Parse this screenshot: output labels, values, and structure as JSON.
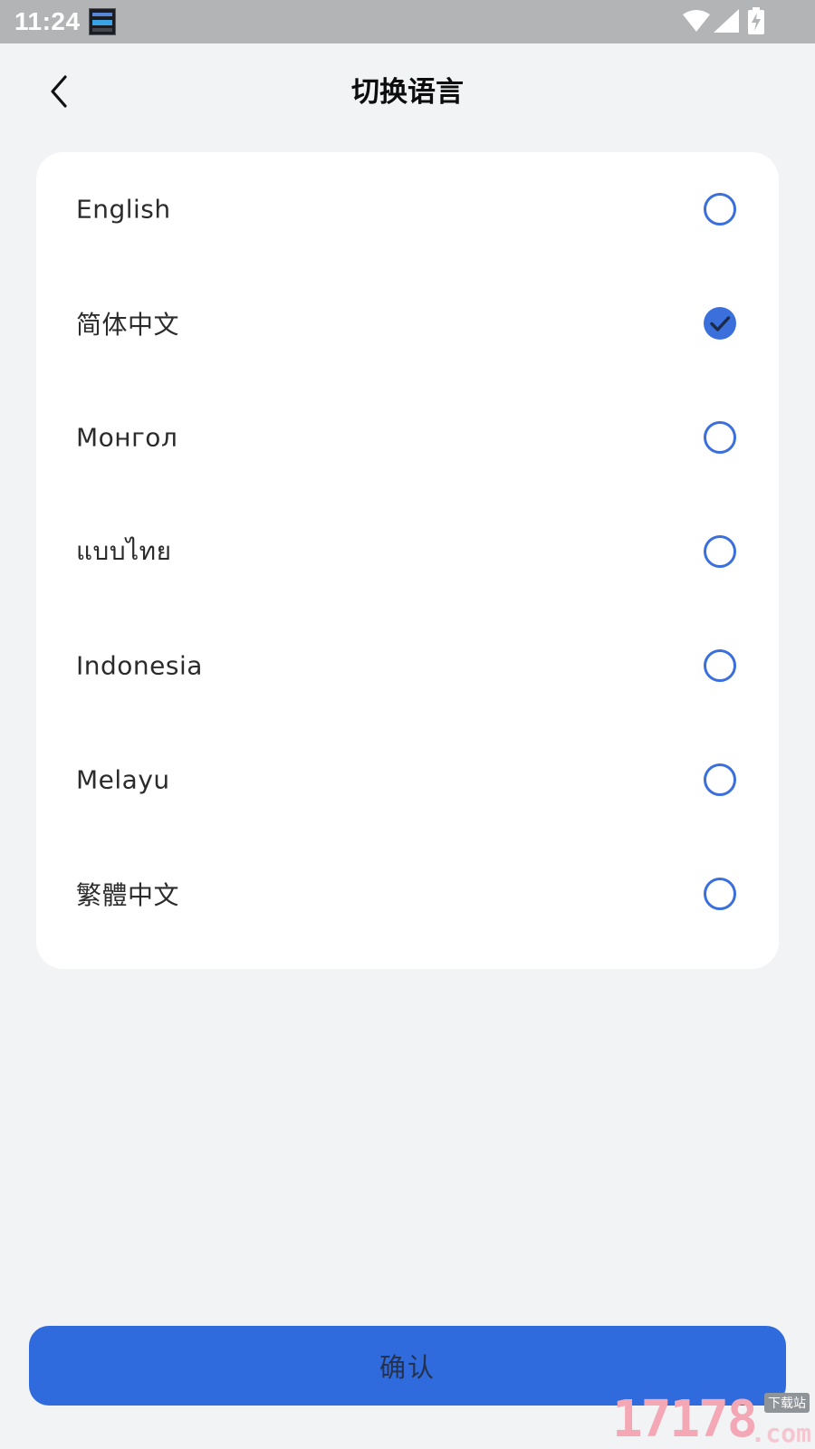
{
  "status_bar": {
    "time": "11:24",
    "icons": [
      "app-notification-icon",
      "wifi-icon",
      "signal-icon",
      "battery-charging-icon"
    ]
  },
  "header": {
    "title": "切换语言",
    "back_icon": "chevron-left-icon"
  },
  "languages": [
    {
      "label": "English",
      "selected": false
    },
    {
      "label": "简体中文",
      "selected": true
    },
    {
      "label": "Монгол",
      "selected": false
    },
    {
      "label": "แบบไทย",
      "selected": false
    },
    {
      "label": "Indonesia",
      "selected": false
    },
    {
      "label": "Melayu",
      "selected": false
    },
    {
      "label": "繁體中文",
      "selected": false
    }
  ],
  "confirm_button": {
    "label": "确认"
  },
  "watermark": {
    "digits": "17178",
    "site": "下载站",
    "suffix": ".com"
  },
  "colors": {
    "accent": "#3a6fdc",
    "button": "#2f6bdc",
    "background": "#f2f3f5",
    "card": "#ffffff",
    "status_bar": "#b3b4b6"
  }
}
